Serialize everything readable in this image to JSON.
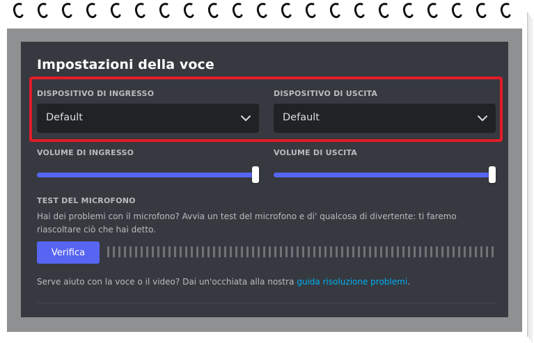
{
  "section_title": "Impostazioni della voce",
  "input_device": {
    "label": "DISPOSITIVO DI INGRESSO",
    "value": "Default"
  },
  "output_device": {
    "label": "DISPOSITIVO DI USCITA",
    "value": "Default"
  },
  "input_volume": {
    "label": "VOLUME DI INGRESSO",
    "level_percent": 100
  },
  "output_volume": {
    "label": "VOLUME DI USCITA",
    "level_percent": 100
  },
  "mic_test": {
    "title": "TEST DEL MICROFONO",
    "description": "Hai dei problemi con il microfono? Avvia un test del microfono e di' qualcosa di divertente: ti faremo riascoltare ciò che hai detto.",
    "button_label": "Verifica"
  },
  "help": {
    "text": "Serve aiuto con la voce o il video? Dai un'occhiata alla nostra ",
    "link_text": "guida risoluzione problemi",
    "suffix": "."
  },
  "colors": {
    "accent": "#5865f2",
    "highlight_border": "#e11d2a",
    "panel_bg": "#36393f",
    "link": "#00aff4"
  },
  "icons": [
    "chevron-down-icon"
  ]
}
